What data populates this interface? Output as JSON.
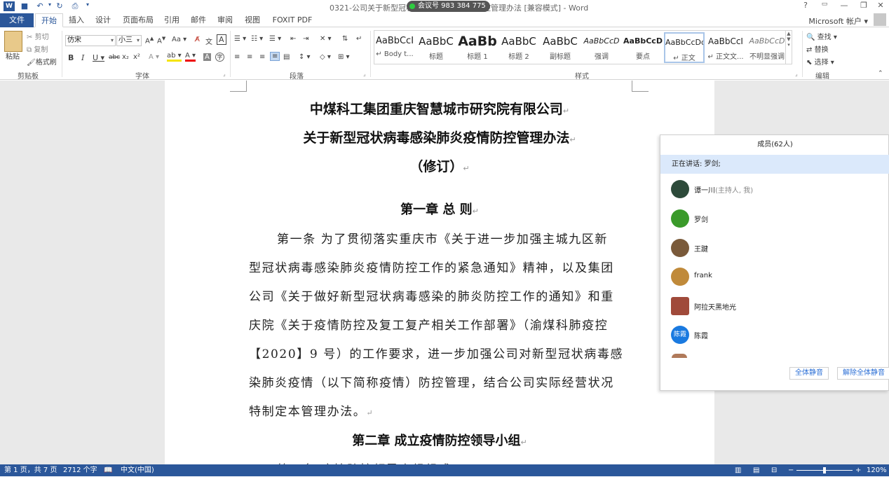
{
  "titlebar": {
    "doc_title": "0321-公司关于新型冠状病毒感染肺炎疫情防控管理办法 [兼容模式] - Word",
    "meeting_id": "会议号 983 384 775",
    "minimize": "—",
    "restore": "❐",
    "close": "✕",
    "help": "?"
  },
  "tabs": [
    "文件",
    "开始",
    "插入",
    "设计",
    "页面布局",
    "引用",
    "邮件",
    "审阅",
    "视图",
    "FOXIT PDF"
  ],
  "account": "Microsoft 帐户",
  "ribbon": {
    "clipboard": {
      "paste": "粘贴",
      "cut": "剪切",
      "copy": "复制",
      "format_painter": "格式刷",
      "label": "剪贴板"
    },
    "font": {
      "name": "仿宋",
      "size": "小三",
      "label": "字体"
    },
    "paragraph": {
      "label": "段落"
    },
    "styles": {
      "label": "样式",
      "items": [
        {
          "preview": "AaBbCcI",
          "name": "↵ Body t..."
        },
        {
          "preview": "AaBbC",
          "name": "标题"
        },
        {
          "preview": "AaBb",
          "name": "标题 1"
        },
        {
          "preview": "AaBbC",
          "name": "标题 2"
        },
        {
          "preview": "AaBbC",
          "name": "副标题"
        },
        {
          "preview": "AaBbCcD",
          "name": "强调"
        },
        {
          "preview": "AaBbCcD",
          "name": "要点"
        },
        {
          "preview": "AaBbCcDd",
          "name": "↵ 正文"
        },
        {
          "preview": "AaBbCcI",
          "name": "↵ 正文文..."
        },
        {
          "preview": "AaBbCcD",
          "name": "不明显强调"
        }
      ]
    },
    "editing": {
      "find": "查找",
      "replace": "替换",
      "select": "选择",
      "label": "编辑"
    }
  },
  "document": {
    "title1": "中煤科工集团重庆智慧城市研究院有限公司",
    "title2": "关于新型冠状病毒感染肺炎疫情防控管理办法",
    "title3": "（修订）",
    "chapter1": "第一章  总  则",
    "para1_lines": [
      "第一条  为了贯彻落实重庆市《关于进一步加强主城九区新",
      "型冠状病毒感染肺炎疫情防控工作的紧急通知》精神，以及集团",
      "公司《关于做好新型冠状病毒感染的肺炎防控工作的通知》和重",
      "庆院《关于疫情防控及复工复产相关工作部署》（渝煤科肺疫控",
      "【2020】9 号）的工作要求，进一步加强公司对新型冠状病毒感",
      "染肺炎疫情（以下简称疫情）防控管理，结合公司实际经营状况",
      "特制定本管理办法。"
    ],
    "chapter2": "第二章  成立疫情防控领导小组",
    "next_line": "第二条  疫情防控领导小组组成"
  },
  "panel": {
    "title": "成员(62人)",
    "speaking_label": "正在讲话: 罗剑;",
    "members": [
      {
        "name": "谭一川",
        "role": "(主持人, 我)",
        "avatar_color": "#2d4a3a"
      },
      {
        "name": "罗剑",
        "role": "",
        "avatar_color": "#3a9a2a"
      },
      {
        "name": "王踺",
        "role": "",
        "avatar_color": "#7a5a3a"
      },
      {
        "name": "frank",
        "role": "",
        "avatar_color": "#c08a3a"
      },
      {
        "name": "阿拉天黑地光",
        "role": "",
        "avatar_color": "#a04a3a"
      },
      {
        "name": "陈霞",
        "role": "",
        "avatar_color": "#1a7ae0",
        "avatar_text": "陈霞"
      }
    ],
    "mute_all": "全体静音",
    "unmute_all": "解除全体静音"
  },
  "status": {
    "page": "第 1 页，共 7 页",
    "words": "2712 个字",
    "lang": "中文(中国)",
    "zoom": "120%",
    "zoom_minus": "−",
    "zoom_plus": "+"
  }
}
